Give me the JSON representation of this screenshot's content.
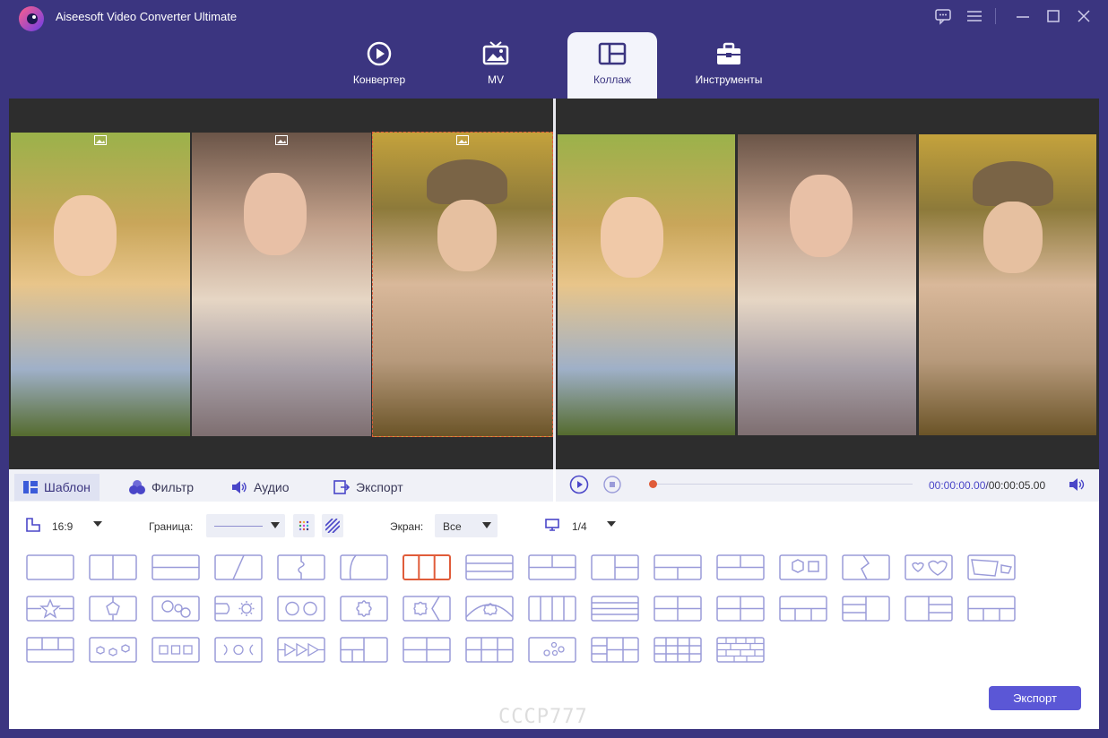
{
  "app": {
    "title": "Aiseesoft Video Converter Ultimate"
  },
  "tabs": [
    {
      "label": "Конвертер",
      "icon": "converter-icon"
    },
    {
      "label": "MV",
      "icon": "mv-icon"
    },
    {
      "label": "Коллаж",
      "icon": "collage-icon",
      "active": true
    },
    {
      "label": "Инструменты",
      "icon": "toolbox-icon"
    }
  ],
  "subtabs": [
    {
      "label": "Шаблон",
      "icon": "template-icon",
      "active": true
    },
    {
      "label": "Фильтр",
      "icon": "filter-icon"
    },
    {
      "label": "Аудио",
      "icon": "audio-icon"
    },
    {
      "label": "Экспорт",
      "icon": "export-icon"
    }
  ],
  "player": {
    "current_time": "00:00:00.00",
    "total_time": "00:00:05.00",
    "time_display": "00:00:00.00/00:00:05.00",
    "progress": 0
  },
  "options": {
    "aspect_ratio": "16:9",
    "border_label": "Граница:",
    "screen_label": "Экран:",
    "screen_value": "Все",
    "page_indicator": "1/4"
  },
  "templates": {
    "count": 47,
    "selected_index": 6
  },
  "actions": {
    "export_label": "Экспорт"
  },
  "watermark": "CCCP777",
  "colors": {
    "brand": "#3b3580",
    "accent": "#5b57d6",
    "selected": "#e05c3a",
    "template_stroke": "#9a9bd9"
  }
}
